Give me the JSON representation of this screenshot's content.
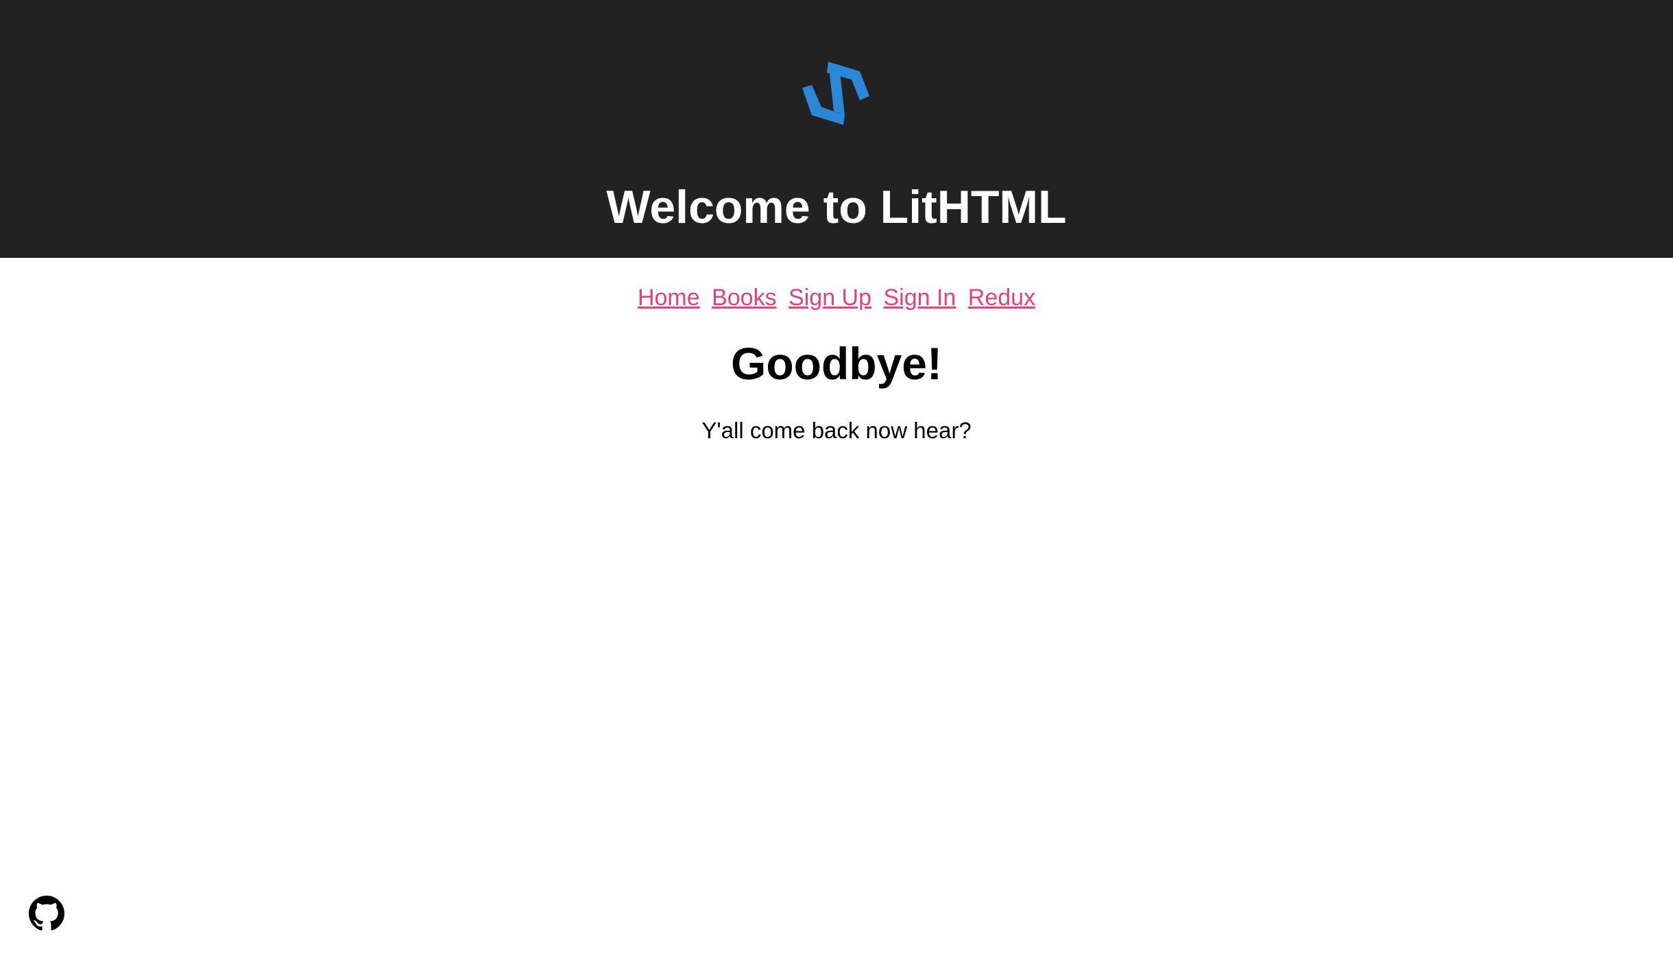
{
  "header": {
    "logo_icon": "lithtml-logo-icon",
    "title": "Welcome to LitHTML",
    "background_color": "#222222",
    "logo_color": "#2d87d8"
  },
  "nav": {
    "link_color": "#e0417f",
    "links": [
      {
        "label": "Home"
      },
      {
        "label": "Books"
      },
      {
        "label": "Sign Up"
      },
      {
        "label": "Sign In"
      },
      {
        "label": "Redux"
      }
    ]
  },
  "main": {
    "heading": "Goodbye!",
    "message": "Y'all come back now hear?"
  },
  "footer": {
    "github_icon": "github-icon"
  }
}
